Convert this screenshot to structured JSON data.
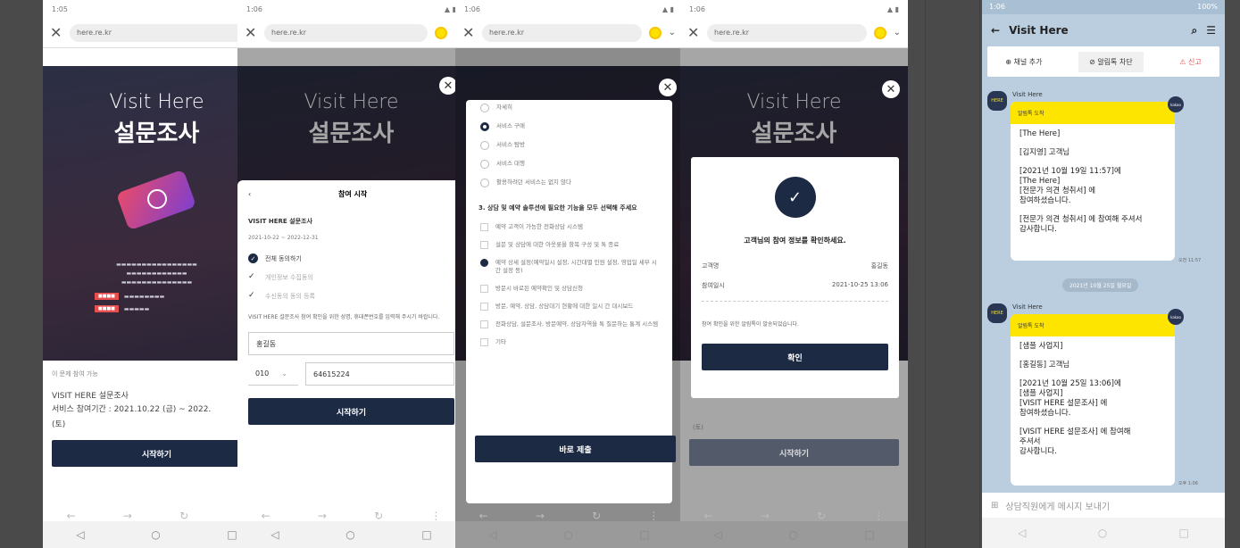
{
  "phones": [
    {
      "status_time": "1:05",
      "url": "here.re.kr"
    },
    {
      "status_time": "1:06",
      "url": "here.re.kr"
    },
    {
      "status_time": "1:06",
      "url": "here.re.kr"
    },
    {
      "status_time": "1:06",
      "url": "here.re.kr"
    }
  ],
  "hero": {
    "line1": "Visit Here",
    "line2": "설문조사"
  },
  "p1": {
    "participate_label": "이 문제 참여 가능",
    "survey_title": "VISIT HERE 설문조사",
    "period": "서비스 참여기간 : 2021.10.22 (금) ~ 2022.",
    "period_tail": "(토)",
    "start_button": "시작하기"
  },
  "p2": {
    "sheet_title": "참여 시작",
    "survey_name": "VISIT HERE 설문조사",
    "date_range": "2021-10-22 ~ 2022-12-31",
    "agree_all": "전체 동의하기",
    "agree_1": "개인정보 수집동의",
    "agree_2": "수신동의 동의 등록",
    "notice": "VISIT HERE 설문조사 참여 확인을 위한 성명, 휴대폰번호를 입력해 주시기 바랍니다.",
    "name_value": "홍길동",
    "prefix_value": "010",
    "phone_value": "64615224",
    "start_button": "시작하기"
  },
  "p3": {
    "opt_top": "자세히",
    "opt1": "서비스 구매",
    "opt2": "서비스 탐방",
    "opt3": "서비스 대행",
    "opt4": "활용하려던 서비스는 없지 않다",
    "question": "3. 상담 및 예약 솔루션에 필요한 기능을 모두 선택해 주세요",
    "c1": "예약 고객이 가능한 전화상담 시스템",
    "c2": "설문 및 상담에 대한 아웃룻을 항목 구성 및 톡 종료",
    "c3": "예약 상세 설정(예약일시 설정, 시간대별 인원 설정, 영업일 세부 시간 설정 등)",
    "c4": "방문시 바로된 예약확인 및 상담신청",
    "c5": "방문, 예약, 상담, 상담대기 현황에 대한 일시 간 대시보드",
    "c6": "전화상담, 설문조사, 방문예약, 상담자역을 톡 질문하는 통계 시스템",
    "c7": "기타",
    "submit_button": "바로 제출"
  },
  "p4": {
    "confirm_text": "고객님의 참여 정보를 확인하세요.",
    "k_name": "고객명",
    "v_name": "홍길동",
    "k_time": "참여일시",
    "v_time": "2021-10-25 13:06",
    "note": "참여 확인을 위한 알림톡이 발송되었습니다.",
    "confirm_button": "확인",
    "start_button": "시작하기",
    "tail": "(토)"
  },
  "chat": {
    "status_time": "1:06",
    "battery": "100%",
    "title": "Visit Here",
    "action_add": "채널 추가",
    "action_block": "알림톡 차단",
    "action_report": "신고",
    "messages": [
      {
        "sender": "Visit Here",
        "header": "알림톡 도착",
        "lines": [
          "[The Here]",
          "[김지영] 고객님",
          "[2021년 10월 19일 11:57]에\n[The Here]\n[전문가 의견 청취서] 에\n참여하셨습니다.",
          "[전문가 의견 청취서] 에 참여해 주셔서\n감사합니다."
        ],
        "time": "오전 11:57"
      },
      {
        "sender": "Visit Here",
        "header": "알림톡 도착",
        "lines": [
          "[샘플 사업지]",
          "[홍길동] 고객님",
          "[2021년 10월 25일 13:06]에\n[샘플 사업지]\n[VISIT HERE 설문조사] 에\n참여하셨습니다.",
          "[VISIT HERE 설문조사] 에 참여해\n주셔서\n감사합니다."
        ],
        "time": "오후 1:06"
      }
    ],
    "date_chip": "2021년 10월 25일 월요일",
    "input_placeholder": "상담직원에게 메시지 보내기",
    "badge": "kakao"
  }
}
